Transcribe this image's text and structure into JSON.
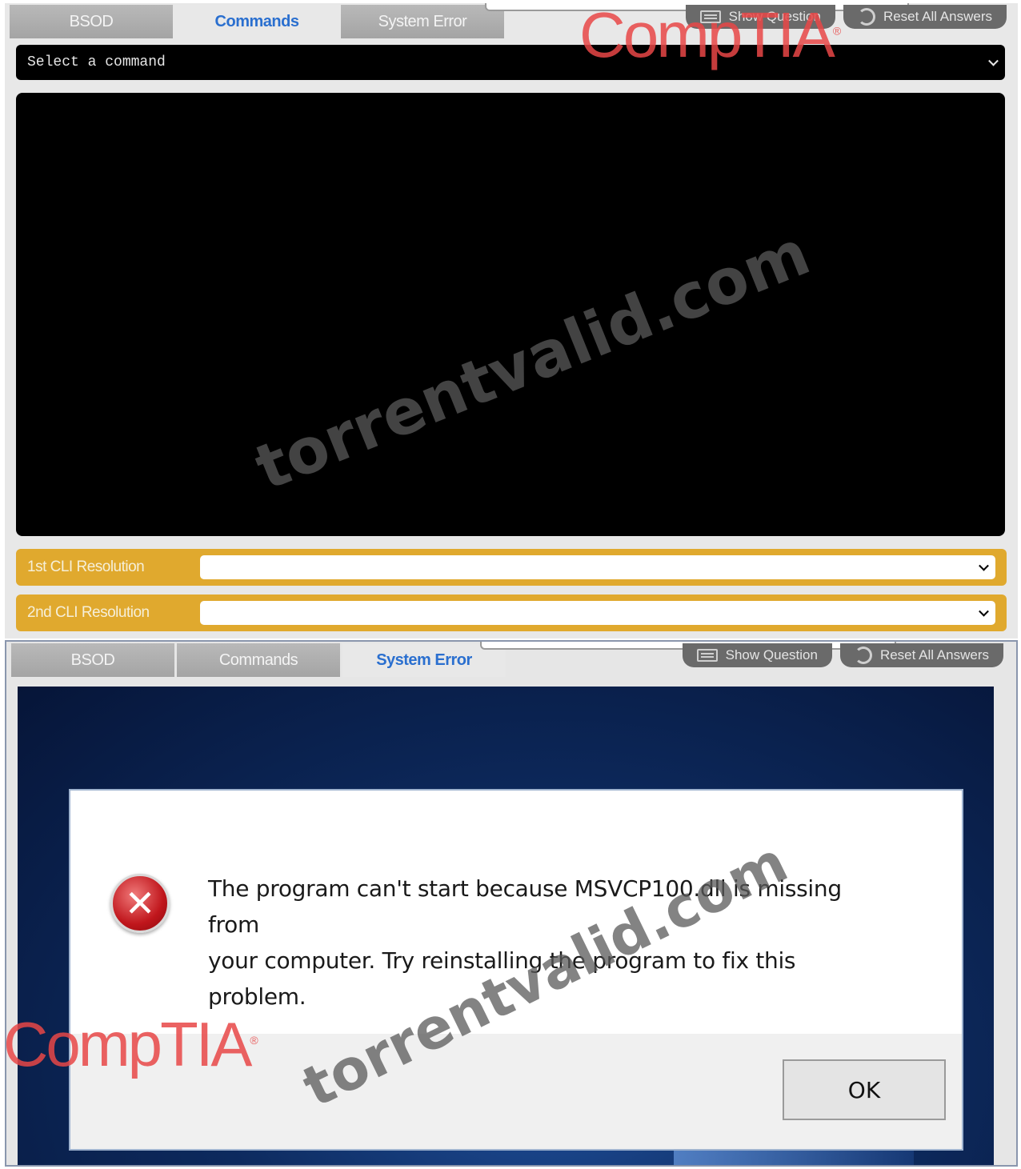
{
  "panel_top": {
    "tabs": [
      {
        "label": "BSOD",
        "active": false
      },
      {
        "label": "Commands",
        "active": true
      },
      {
        "label": "System Error",
        "active": false
      }
    ],
    "show_question": "Show Question",
    "reset_all": "Reset All Answers",
    "command_select": "Select a command",
    "resolution_1_label": "1st CLI Resolution",
    "resolution_2_label": "2nd CLI Resolution",
    "resolution_1_value": "",
    "resolution_2_value": ""
  },
  "panel_bottom": {
    "tabs": [
      {
        "label": "BSOD",
        "active": false
      },
      {
        "label": "Commands",
        "active": false
      },
      {
        "label": "System Error",
        "active": true
      }
    ],
    "show_question": "Show Question",
    "reset_all": "Reset All Answers",
    "dialog": {
      "message_line1": "The program can't start because MSVCP100.dll is missing from",
      "message_line2": "your computer. Try reinstalling the program to fix this problem.",
      "ok_label": "OK",
      "icon": "error-icon"
    }
  },
  "watermark": {
    "text": "torrentvalid.com",
    "logo_text": "CompTIA"
  },
  "colors": {
    "active_tab_text": "#2a6fcf",
    "resolution_bar": "#e0a92e",
    "logo": "#e84646"
  }
}
